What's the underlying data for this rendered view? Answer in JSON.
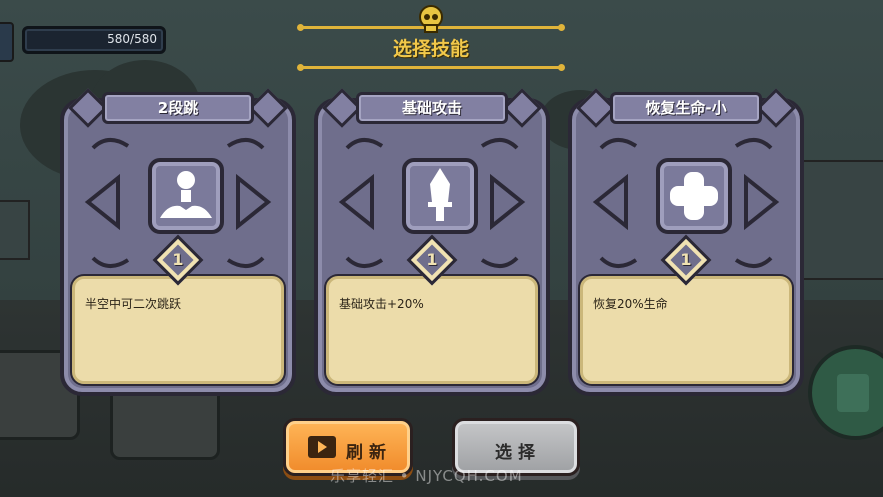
{
  "hud": {
    "hp_text": "580/580"
  },
  "title": "选择技能",
  "cards": [
    {
      "name": "2段跳",
      "level": "1",
      "description": "半空中可二次跳跃",
      "icon": "double-jump-icon"
    },
    {
      "name": "基础攻击",
      "level": "1",
      "description": "基础攻击+20%",
      "icon": "sword-icon"
    },
    {
      "name": "恢复生命-小",
      "level": "1",
      "description": "恢复20%生命",
      "icon": "heal-cross-icon"
    }
  ],
  "buttons": {
    "refresh": "刷新",
    "select": "选择"
  },
  "watermark": "乐享轻汇 • NJYCQH.COM",
  "colors": {
    "title": "#f1c84a",
    "card": "#6f6e8c",
    "desc_bg": "#ecdcaa",
    "refresh": "#f59a38",
    "select": "#b3b4b7"
  }
}
